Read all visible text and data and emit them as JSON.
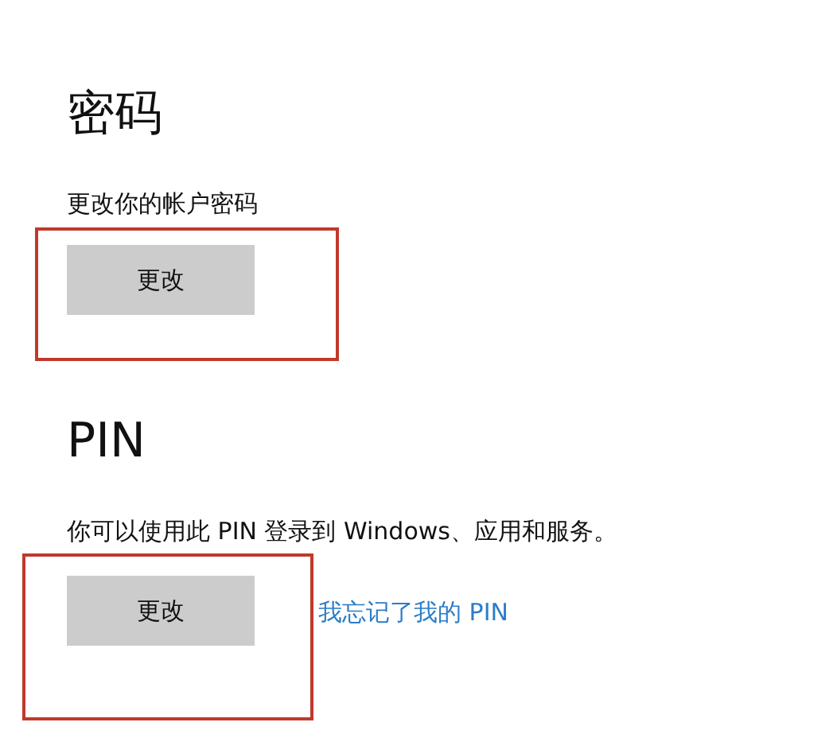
{
  "password_section": {
    "heading": "密码",
    "description": "更改你的帐户密码",
    "button": "更改"
  },
  "pin_section": {
    "heading": "PIN",
    "description": "你可以使用此 PIN 登录到 Windows、应用和服务。",
    "button": "更改",
    "link": "我忘记了我的 PIN"
  }
}
